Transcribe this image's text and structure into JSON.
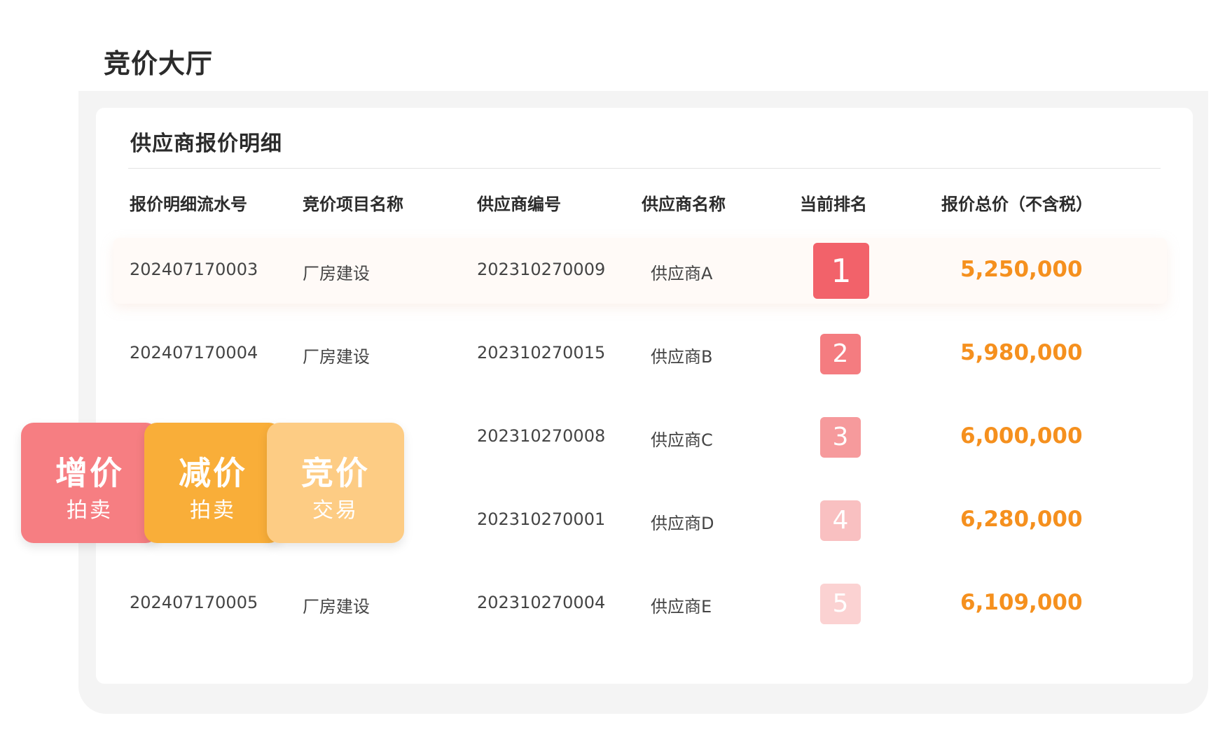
{
  "page": {
    "title": "竞价大厅"
  },
  "card": {
    "title": "供应商报价明细"
  },
  "table": {
    "headers": [
      "报价明细流水号",
      "竞价项目名称",
      "供应商编号",
      "供应商名称",
      "当前排名",
      "报价总价（不含税）"
    ],
    "rows": [
      {
        "serial": "202407170003",
        "project": "厂房建设",
        "supplier_no": "202310270009",
        "supplier_name": "供应商A",
        "rank": "1",
        "price": "5,250,000"
      },
      {
        "serial": "202407170004",
        "project": "厂房建设",
        "supplier_no": "202310270015",
        "supplier_name": "供应商B",
        "rank": "2",
        "price": "5,980,000"
      },
      {
        "serial": "",
        "project": "",
        "supplier_no": "202310270008",
        "supplier_name": "供应商C",
        "rank": "3",
        "price": "6,000,000"
      },
      {
        "serial": "",
        "project": "",
        "supplier_no": "202310270001",
        "supplier_name": "供应商D",
        "rank": "4",
        "price": "6,280,000"
      },
      {
        "serial": "202407170005",
        "project": "厂房建设",
        "supplier_no": "202310270004",
        "supplier_name": "供应商E",
        "rank": "5",
        "price": "6,109,000"
      }
    ]
  },
  "tiles": [
    {
      "main": "增价",
      "sub": "拍卖"
    },
    {
      "main": "减价",
      "sub": "拍卖"
    },
    {
      "main": "竞价",
      "sub": "交易"
    }
  ],
  "colors": {
    "price": "#f5901e",
    "rank": [
      "#f2626a",
      "#f47c80",
      "#f69a9c",
      "#f9c0c1",
      "#fbd2d2"
    ],
    "tiles": [
      "#f67e82",
      "#f9ae39",
      "#fdcc84"
    ]
  }
}
